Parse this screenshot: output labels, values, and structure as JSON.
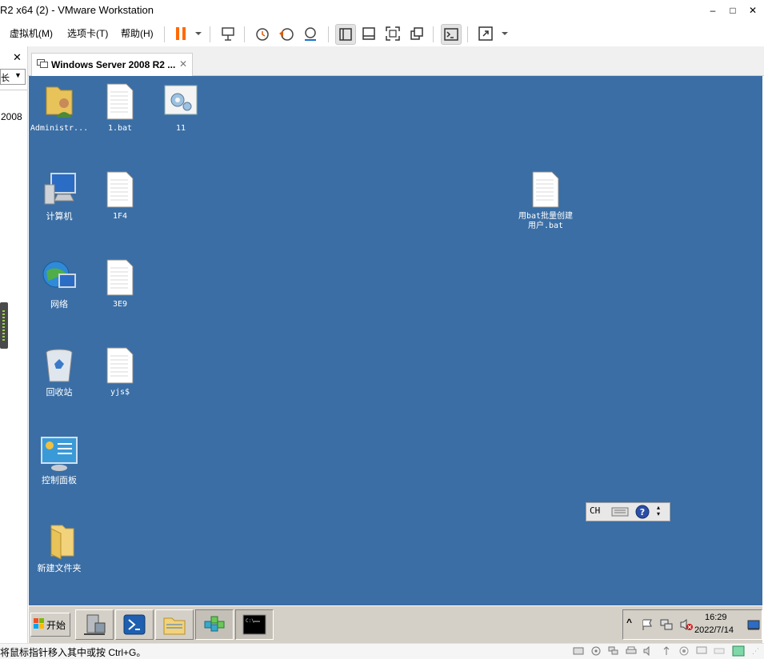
{
  "window": {
    "title": "R2 x64 (2) - VMware Workstation",
    "minimize": "–",
    "maximize": "□",
    "close": "✕"
  },
  "menu": {
    "items": [
      "虚拟机(M)",
      "选项卡(T)",
      "帮助(H)"
    ]
  },
  "library": {
    "close": "✕",
    "dropdown_text": "长",
    "item": "2008"
  },
  "tab": {
    "title": "Windows Server 2008 R2 ...",
    "close": "✕"
  },
  "desktop": {
    "icons": [
      {
        "label": "Administr...",
        "icon": "user-folder-icon"
      },
      {
        "label": "1.bat",
        "icon": "file-icon"
      },
      {
        "label": "11",
        "icon": "settings-file-icon"
      },
      {
        "label": "计算机",
        "icon": "computer-icon"
      },
      {
        "label": "1F4",
        "icon": "file-icon"
      },
      {
        "label": "用bat批量创建用户.bat",
        "icon": "file-icon"
      },
      {
        "label": "网络",
        "icon": "network-icon"
      },
      {
        "label": "3E9",
        "icon": "file-icon"
      },
      {
        "label": "回收站",
        "icon": "recycle-bin-icon"
      },
      {
        "label": "yjs$",
        "icon": "file-icon"
      },
      {
        "label": "控制面板",
        "icon": "control-panel-icon"
      },
      {
        "label": "新建文件夹",
        "icon": "folder-icon"
      }
    ]
  },
  "language_bar": {
    "lang": "CH"
  },
  "taskbar": {
    "start_label": "开始",
    "clock_time": "16:29",
    "clock_date": "2022/7/14",
    "tray_expand": "^"
  },
  "statusbar": {
    "text": "将鼠标指针移入其中或按 Ctrl+G。"
  },
  "colors": {
    "desktop": "#3a6ea5",
    "taskbar": "#d4d0c8",
    "pause_accent": "#ff6a00"
  }
}
